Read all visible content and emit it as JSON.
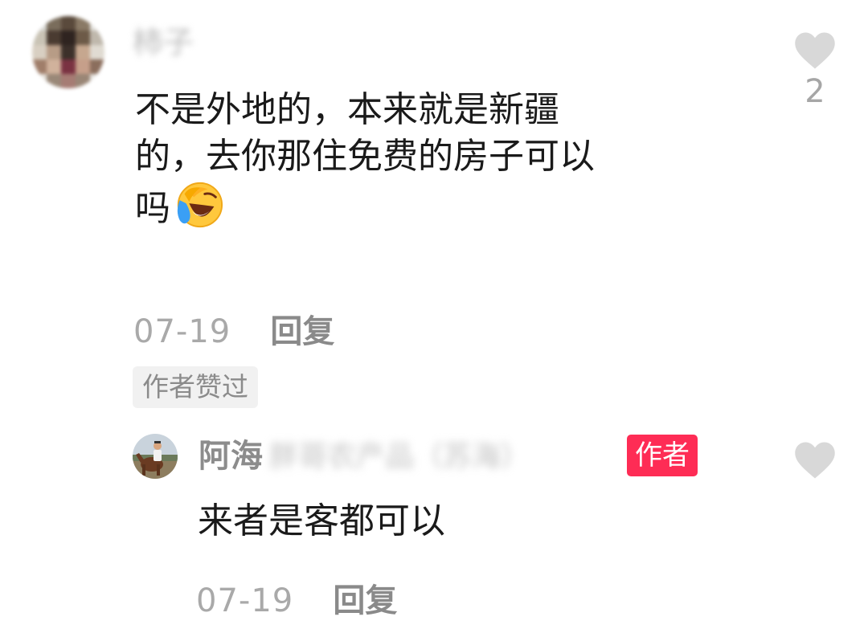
{
  "comment": {
    "user_name": "柿子",
    "text_lines": [
      "不是外地的，本来就是新疆",
      "的，去你那住免费的房子可以",
      "吗"
    ],
    "emoji": "laugh-cry-emoji",
    "date": "07-19",
    "reply_label": "回复",
    "author_liked_badge": "作者赞过",
    "like_icon": "heart-icon",
    "like_count": "2"
  },
  "reply": {
    "user_name": "阿海",
    "user_name_suffix": "胖哥农产品（苏海）",
    "author_badge": "作者",
    "text": "来者是客都可以",
    "date": "07-19",
    "reply_label": "回复",
    "like_icon": "heart-icon"
  },
  "colors": {
    "author_badge_bg": "#fe2c55",
    "heart": "#d8d8d8",
    "meta_text": "#a9a9a9"
  }
}
